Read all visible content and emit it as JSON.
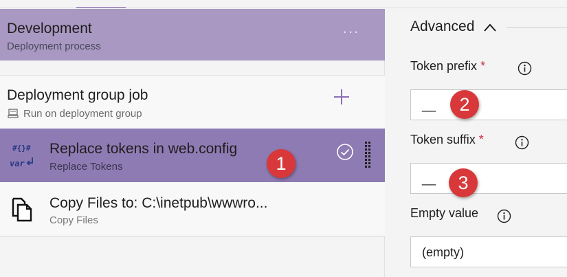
{
  "pipeline": {
    "stage": {
      "title": "Development",
      "subtitle": "Deployment process",
      "more_label": "···"
    },
    "group_job": {
      "title": "Deployment group job",
      "subtitle": "Run on deployment group"
    },
    "tasks": [
      {
        "title": "Replace tokens in web.config",
        "subtitle": "Replace Tokens",
        "icon": "replace-tokens-icon",
        "selected": true
      },
      {
        "title": "Copy Files to: C:\\inetpub\\wwwro...",
        "subtitle": "Copy Files",
        "icon": "copy-files-icon",
        "selected": false
      }
    ]
  },
  "properties": {
    "section_title": "Advanced",
    "fields": [
      {
        "label": "Token prefix",
        "required": true,
        "value": "__"
      },
      {
        "label": "Token suffix",
        "required": true,
        "value": "__"
      },
      {
        "label": "Empty value",
        "required": false,
        "value": "(empty)"
      }
    ],
    "required_marker": "*"
  },
  "callouts": [
    "1",
    "2",
    "3"
  ],
  "colors": {
    "stage_bg": "#a898c2",
    "selected_task_bg": "#8f7bb3",
    "accent": "#8a6fb5",
    "callout": "#d8383a",
    "required": "#c4314b"
  }
}
